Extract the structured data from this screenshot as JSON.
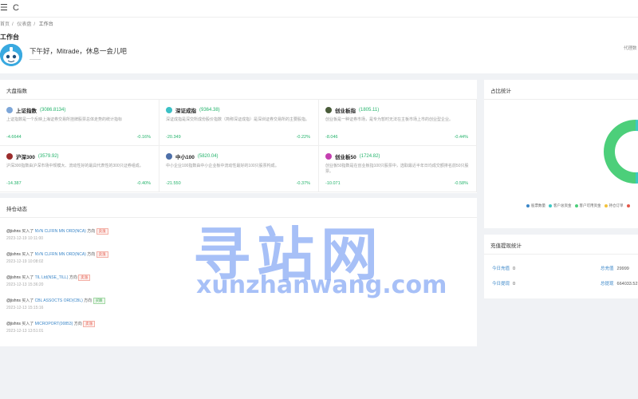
{
  "topbar": {
    "menu_icon": "☰",
    "refresh_icon": "C"
  },
  "breadcrumb": [
    "首页",
    "仪表盘",
    "工作台"
  ],
  "header": {
    "title": "工作台",
    "greeting": "下午好，Mitrade，休息一会儿吧",
    "sub": "——",
    "right": "代理数"
  },
  "market": {
    "title": "大盘指数",
    "indices": [
      {
        "name": "上证指数",
        "value": "(3086.8134)",
        "desc": "上证指数是一个反映上海证券交易所挂牌股票总体走势的统计指标",
        "left": "-4.6644",
        "right": "-0.16%",
        "color": "#7da6d8"
      },
      {
        "name": "深证成指",
        "value": "(9364.38)",
        "desc": "深证成指是深交所成份股价指数（简称深证成指）是深圳证券交易所的主要股指。",
        "left": "-20.349",
        "right": "-0.22%",
        "color": "#3cc1c6"
      },
      {
        "name": "创业板指",
        "value": "(1805.11)",
        "desc": "创业板是一种证券市场，是专为暂时无法在主板市场上市的创业型企业。",
        "left": "-8.046",
        "right": "-0.44%",
        "color": "#4a5c3a"
      },
      {
        "name": "沪深300",
        "value": "(3579.92)",
        "desc": "沪深300指数由沪深市场中规模大、流动性好的最具代表性的300只证券组成。",
        "left": "-14.387",
        "right": "-0.40%",
        "color": "#9b2c2c"
      },
      {
        "name": "中小100",
        "value": "(5820.04)",
        "desc": "中小企业100指数由中小企业板中流动性最好的100只股票构成。",
        "left": "-21.550",
        "right": "-0.37%",
        "color": "#4d6fa8"
      },
      {
        "name": "创业板50",
        "value": "(1724.82)",
        "desc": "创业板50指数是在创业板指100只股票中，选取最近半年日均成交额排名前50只股票。",
        "left": "-10.071",
        "right": "-0.58%",
        "color": "#c43fb0"
      }
    ]
  },
  "feed": {
    "title": "持仓动态",
    "items": [
      {
        "user": "@jishns",
        "action": "买入了",
        "symbol": "NVN CLFRN MN ORD(NCA)",
        "dir": "方向",
        "tag": "卖涨",
        "time": "2023-12-19 10:11:00",
        "tag_type": "sell"
      },
      {
        "user": "@jishns",
        "action": "买入了",
        "symbol": "NVN CLFRN MN ORD(NCA)",
        "dir": "方向",
        "tag": "卖涨",
        "time": "2023-12-19 10:08:02",
        "tag_type": "sell"
      },
      {
        "user": "@jishns",
        "action": "买入了",
        "symbol": "TIL Ltd(NSE_TILL)",
        "dir": "方向",
        "tag": "卖涨",
        "time": "2023-12-13 15:36:20",
        "tag_type": "sell"
      },
      {
        "user": "@jishns",
        "action": "买入了",
        "symbol": "CBL ASSOCTS ORD(CBL)",
        "dir": "方向",
        "tag": "买跌",
        "time": "2023-12-13 15:15:16",
        "tag_type": "buy"
      },
      {
        "user": "@jishns",
        "action": "买入了",
        "symbol": "MICROPORT(00853)",
        "dir": "方向",
        "tag": "卖涨",
        "time": "2023-12-13 13:51:01",
        "tag_type": "sell"
      }
    ]
  },
  "ratio": {
    "title": "占比统计",
    "legend": [
      {
        "label": "股票数量",
        "color": "#3a86c8"
      },
      {
        "label": "客户总资金",
        "color": "#3cc9c4"
      },
      {
        "label": "客户可用资金",
        "color": "#4ccf7a"
      },
      {
        "label": "持仓订单",
        "color": "#f3c23a"
      },
      {
        "label": "",
        "color": "#e4584a"
      }
    ],
    "chart_data": {
      "type": "pie",
      "categories": [
        "",
        ""
      ],
      "values": [
        50,
        50
      ],
      "colors": [
        "#3cc9c4",
        "#4ccf7a"
      ]
    }
  },
  "recharge": {
    "title": "充值提现统计",
    "today_recharge_label": "今日充值",
    "today_recharge": "0",
    "today_withdraw_label": "今日提现",
    "today_withdraw": "0",
    "total_recharge_label": "总充值",
    "total_recharge": "29999",
    "total_withdraw_label": "总提现",
    "total_withdraw": "664033.52"
  },
  "watermark": {
    "line1": "寻站网",
    "line2": "xunzhanwang.com"
  }
}
